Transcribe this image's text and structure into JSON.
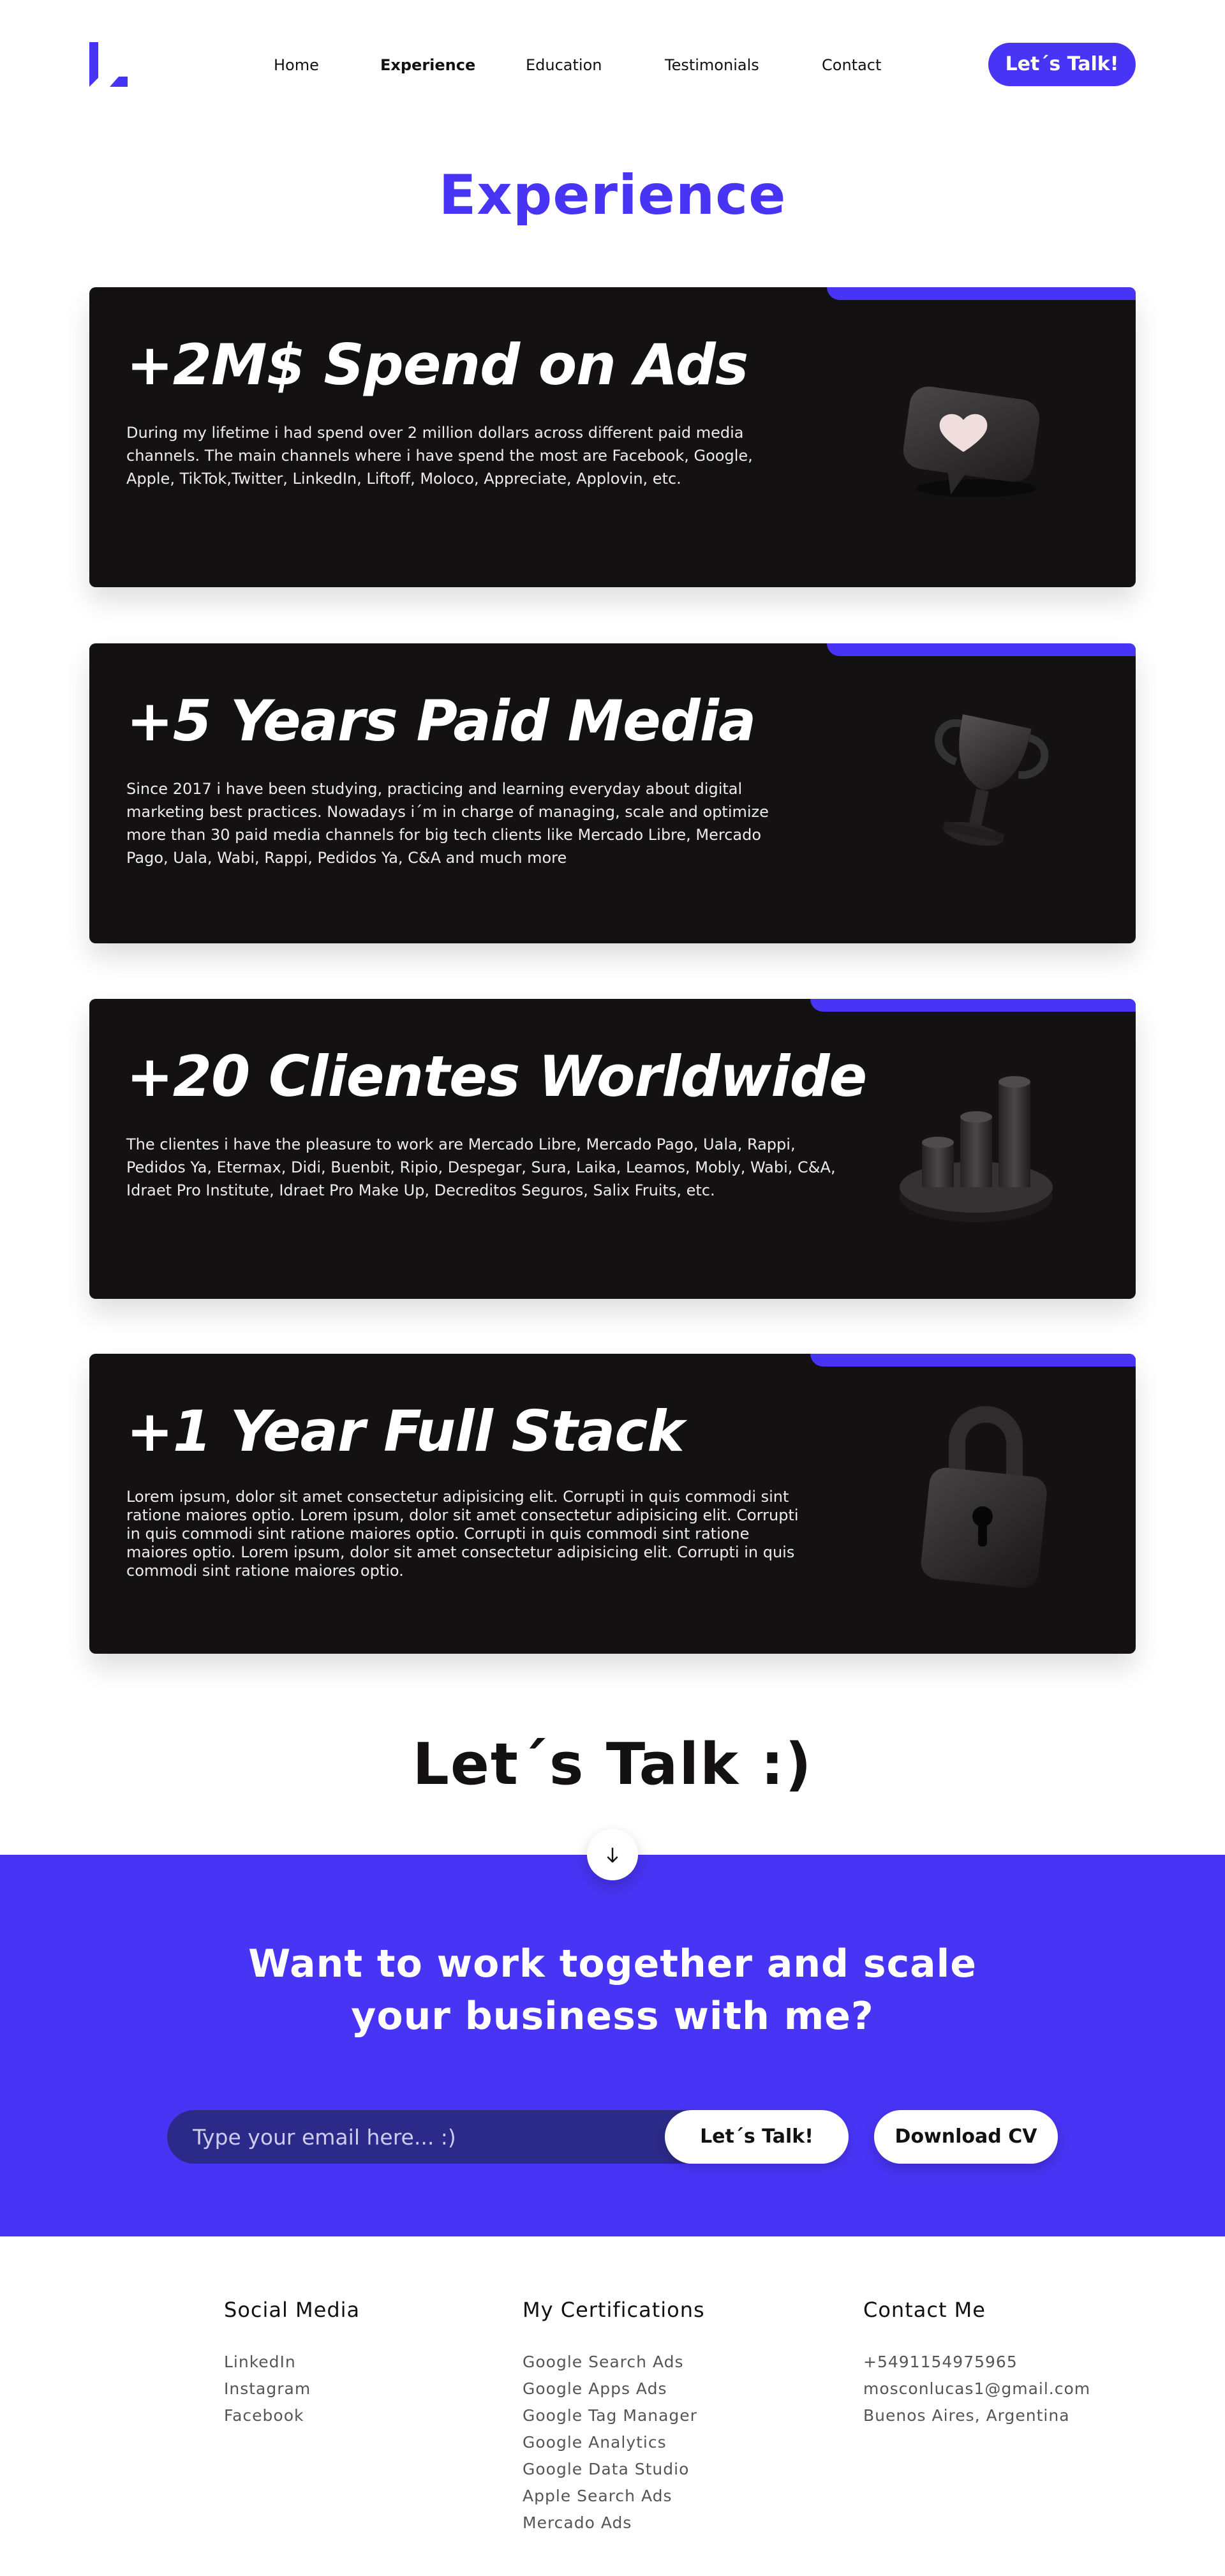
{
  "colors": {
    "brand": "#4834f4",
    "card_bg": "#141112",
    "text_dark": "#111111"
  },
  "header": {
    "logo_icon": "l-logo-mark",
    "nav": [
      {
        "label": "Home",
        "active": false
      },
      {
        "label": "Experience",
        "active": true
      },
      {
        "label": "Education",
        "active": false
      },
      {
        "label": "Testimonials",
        "active": false
      },
      {
        "label": "Contact",
        "active": false
      }
    ],
    "cta_label": "Let´s Talk!"
  },
  "experience": {
    "title": "Experience",
    "cards": [
      {
        "title": "+2M$ Spend on Ads",
        "description": "During my lifetime i had spend over 2 million dollars across different paid media channels. The main channels where i have spend the most are Facebook, Google, Apple, TikTok,Twitter, LinkedIn, Liftoff, Moloco, Appreciate, Applovin, etc.",
        "icon": "heart-like-icon"
      },
      {
        "title": "+5 Years Paid Media",
        "description": "Since 2017 i have been studying, practicing and learning everyday about digital marketing best practices. Nowadays i´m in charge of managing, scale and optimize more than 30 paid media channels for big tech clients like Mercado Libre, Mercado Pago, Uala, Wabi, Rappi, Pedidos Ya, C&A and much more",
        "icon": "trophy-icon"
      },
      {
        "title": "+20 Clientes Worldwide",
        "description": "The clientes i have the pleasure to work are Mercado Libre, Mercado Pago, Uala, Rappi, Pedidos Ya, Etermax, Didi, Buenbit, Ripio, Despegar, Sura, Laika, Leamos, Mobly, Wabi, C&A, Idraet Pro Institute, Idraet Pro Make Up, Decreditos Seguros, Salix Fruits, etc.",
        "icon": "bar-chart-icon"
      },
      {
        "title": "+1 Year Full Stack",
        "description": "Lorem ipsum, dolor sit amet consectetur adipisicing elit. Corrupti in quis commodi sint ratione maiores optio. Lorem ipsum, dolor sit amet consectetur adipisicing elit. Corrupti in quis commodi sint ratione maiores optio. Corrupti in quis commodi sint ratione maiores optio. Lorem ipsum, dolor sit amet consectetur adipisicing elit. Corrupti in quis commodi sint ratione maiores optio.",
        "icon": "padlock-icon"
      }
    ]
  },
  "talk": {
    "title": "Let´s Talk :)",
    "scroll_icon": "arrow-down-icon"
  },
  "contact": {
    "heading_line1": "Want to work together and scale",
    "heading_line2": "your business with me?",
    "email_placeholder": "Type your email here... :)",
    "send_label": "Let´s Talk!",
    "cv_label": "Download CV"
  },
  "footer": {
    "social": {
      "heading": "Social Media",
      "items": [
        "LinkedIn",
        "Instagram",
        "Facebook"
      ]
    },
    "certifications": {
      "heading": "My Certifications",
      "items": [
        "Google Search Ads",
        "Google Apps Ads",
        "Google Tag Manager",
        "Google Analytics",
        "Google Data Studio",
        "Apple Search Ads",
        "Mercado Ads"
      ]
    },
    "contact": {
      "heading": "Contact Me",
      "items": [
        "+5491154975965",
        "mosconlucas1@gmail.com",
        "Buenos Aires, Argentina"
      ]
    }
  }
}
